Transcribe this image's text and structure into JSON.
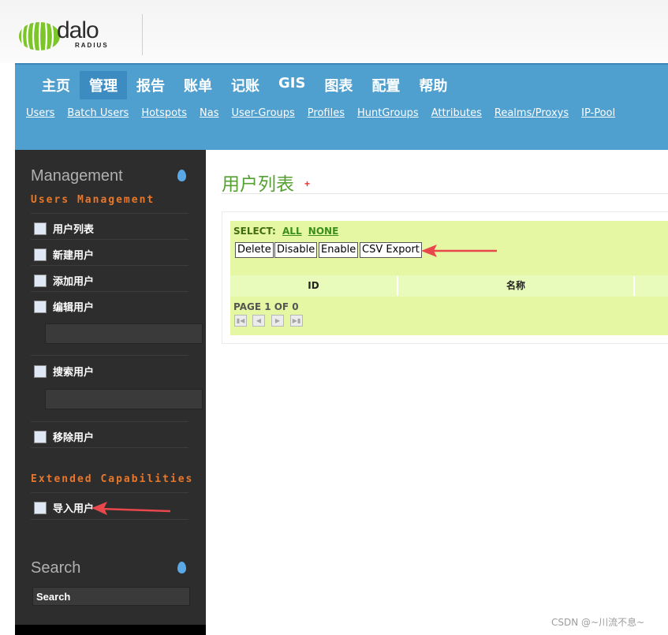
{
  "header": {
    "logo_text": "dalo",
    "logo_subtext": "RADIUS"
  },
  "top_menu": [
    {
      "label": "主页",
      "active": false
    },
    {
      "label": "管理",
      "active": true
    },
    {
      "label": "报告",
      "active": false
    },
    {
      "label": "账单",
      "active": false
    },
    {
      "label": "记账",
      "active": false
    },
    {
      "label": "GIS",
      "active": false
    },
    {
      "label": "图表",
      "active": false
    },
    {
      "label": "配置",
      "active": false
    },
    {
      "label": "帮助",
      "active": false
    }
  ],
  "sub_menu": [
    "Users",
    "Batch Users",
    "Hotspots",
    "Nas",
    "User-Groups",
    "Profiles",
    "HuntGroups",
    "Attributes",
    "Realms/Proxys",
    "IP-Pool"
  ],
  "sidebar": {
    "title": "Management",
    "section_users": "Users Management",
    "items": [
      "用户列表",
      "新建用户",
      "添加用户",
      "编辑用户",
      "搜索用户",
      "移除用户"
    ],
    "section_extended": "Extended Capabilities",
    "extended_items": [
      "导入用户"
    ],
    "search_title": "Search",
    "search_value": "Search"
  },
  "main": {
    "title": "用户列表",
    "plus": "+",
    "select_label": "SELECT:",
    "select_all": "ALL",
    "select_none": "NONE",
    "buttons": [
      "Delete",
      "Disable",
      "Enable",
      "CSV Export"
    ],
    "columns": [
      "ID",
      "名称"
    ],
    "pager_text": "PAGE 1 OF 0"
  },
  "colors": {
    "nav_bg": "#4f9fcf",
    "sidebar_bg": "#2d2d2d",
    "accent_orange": "#e9772a",
    "title_green": "#55a032",
    "panel_green": "#e5f7a3",
    "arrow_red": "#e8474c"
  },
  "watermark": "CSDN @~川流不息~"
}
